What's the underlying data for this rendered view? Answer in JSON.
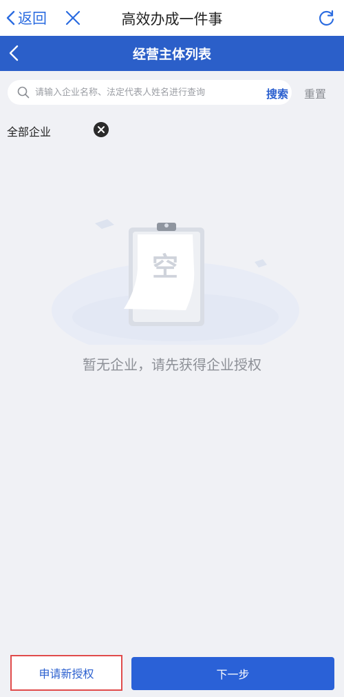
{
  "topbar": {
    "back_label": "返回",
    "title": "高效办成一件事",
    "icons": {
      "back": "chevron-left-icon",
      "close": "close-icon",
      "refresh": "refresh-icon"
    }
  },
  "navbar": {
    "title": "经营主体列表",
    "back_icon": "chevron-left-icon"
  },
  "search": {
    "placeholder": "请输入企业名称、法定代表人姓名进行查询",
    "value": "",
    "search_label": "搜索",
    "reset_label": "重置"
  },
  "filter": {
    "label": "全部企业",
    "clear_icon": "close-circle-icon"
  },
  "empty": {
    "illustration_text": "空",
    "message": "暂无企业，请先获得企业授权"
  },
  "actions": {
    "apply_label": "申请新授权",
    "next_label": "下一步"
  },
  "colors": {
    "brand_blue": "#2b5fc9",
    "highlight_red": "#e04a4a",
    "page_bg": "#f0f1f5"
  }
}
